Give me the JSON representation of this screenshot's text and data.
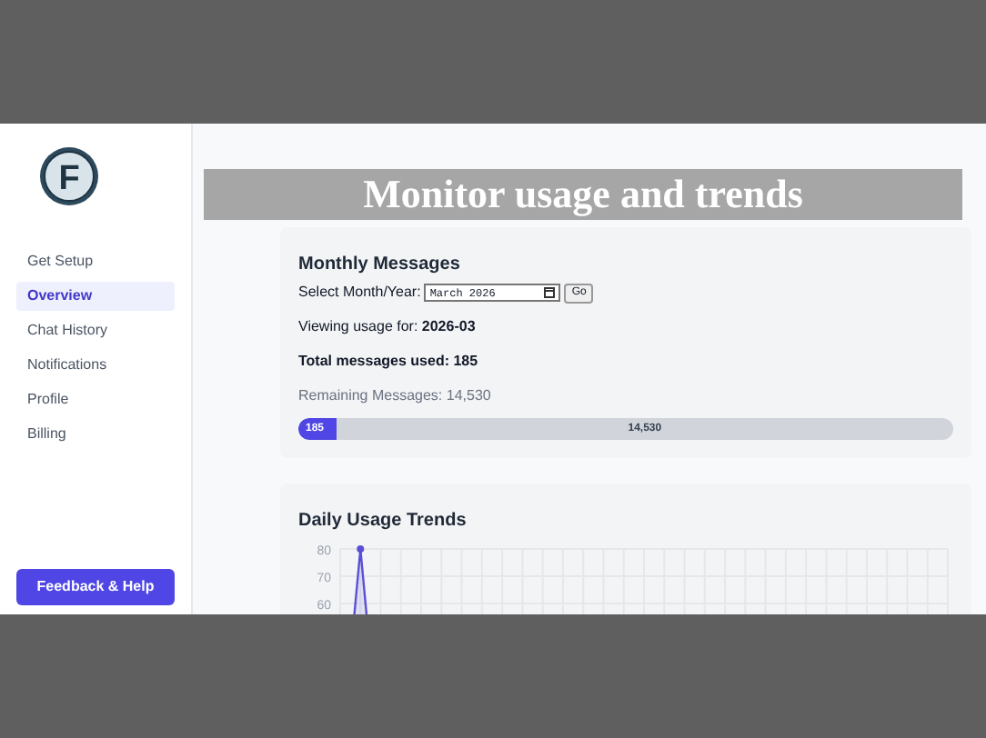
{
  "logo": {
    "letter": "F"
  },
  "sidebar": {
    "items": [
      {
        "label": "Get Setup",
        "selected": false
      },
      {
        "label": "Overview",
        "selected": true
      },
      {
        "label": "Chat History",
        "selected": false
      },
      {
        "label": "Notifications",
        "selected": false
      },
      {
        "label": "Profile",
        "selected": false
      },
      {
        "label": "Billing",
        "selected": false
      }
    ],
    "feedback_button": "Feedback & Help"
  },
  "banner": {
    "title": "Monitor usage and trends"
  },
  "monthly": {
    "title": "Monthly Messages",
    "select_label": "Select Month/Year:",
    "month_value": "March 2026",
    "go_button": "Go",
    "viewing_label": "Viewing usage for:",
    "viewing_value": "2026-03",
    "total": "Total messages used: 185",
    "remaining": "Remaining Messages: 14,530",
    "bar": {
      "level": 0.058,
      "used_label": "185",
      "remaining_label": "14,530"
    }
  },
  "trends": {
    "title": "Daily Usage Trends",
    "chart_data": {
      "type": "area",
      "series": [
        {
          "color": "#5b4fd6",
          "values": [
            0,
            80,
            0,
            0,
            0,
            0,
            0,
            0,
            0,
            0,
            0,
            0,
            0,
            0,
            0,
            0,
            0,
            0,
            0,
            0,
            0,
            0,
            0,
            0,
            0,
            0,
            0,
            0,
            0,
            0,
            0
          ]
        }
      ],
      "yticks": [
        60,
        70,
        80
      ],
      "ylim": [
        0,
        80
      ],
      "grid": true
    }
  }
}
